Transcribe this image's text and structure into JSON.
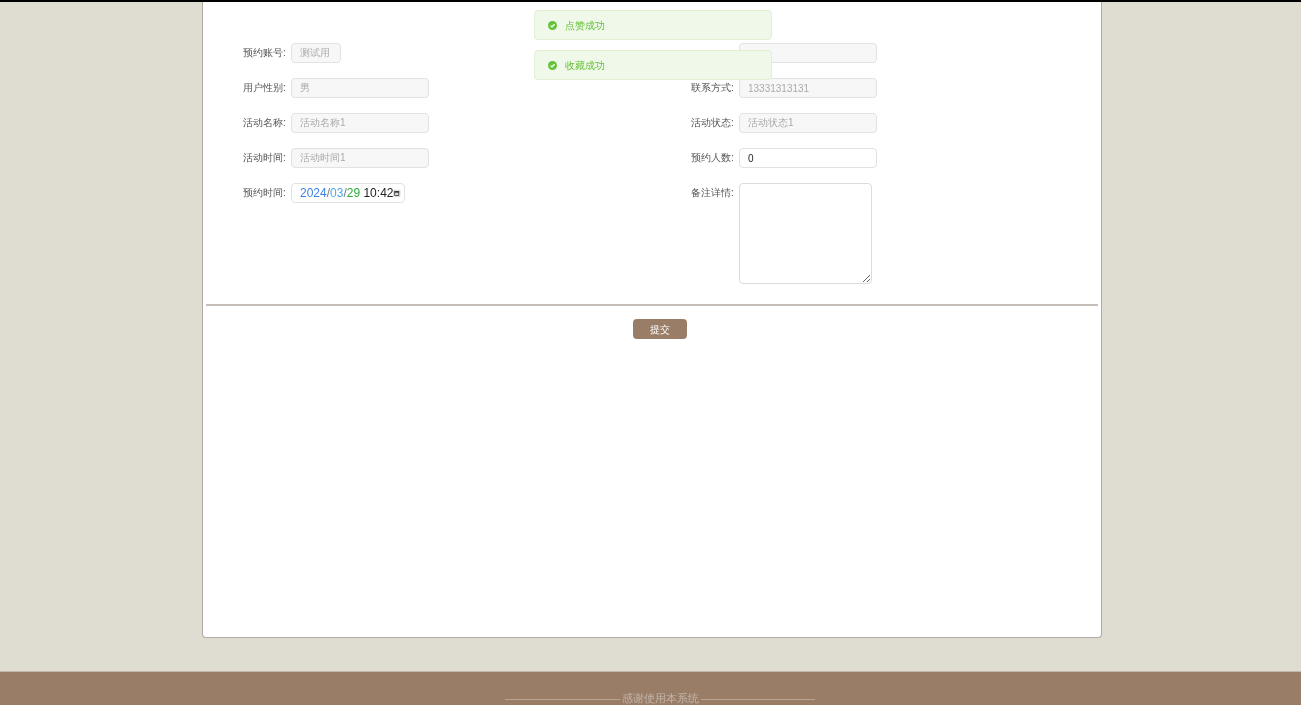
{
  "toasts": [
    {
      "kind": "success",
      "text": "点赞成功"
    },
    {
      "kind": "success",
      "text": "收藏成功"
    }
  ],
  "form": {
    "left": [
      {
        "kind": "short",
        "label": "预约账号:",
        "value": "测试用",
        "disabled": true
      },
      {
        "kind": "input",
        "label": "用户性别:",
        "value": "男",
        "disabled": true
      },
      {
        "kind": "input",
        "label": "活动名称:",
        "value": "活动名称1",
        "disabled": true
      },
      {
        "kind": "input",
        "label": "活动时间:",
        "value": "活动时间1",
        "disabled": true
      },
      {
        "kind": "datetime",
        "label": "预约时间:",
        "parts": [
          {
            "text": "2024",
            "color": "#3a80e0"
          },
          {
            "text": "/"
          },
          {
            "text": "03",
            "color": "#4aa8ee"
          },
          {
            "text": "/"
          },
          {
            "text": "29",
            "color": "#2eaa3c"
          },
          {
            "text": " 10:42",
            "color": "#222222"
          }
        ]
      }
    ],
    "right": [
      {
        "kind": "covered"
      },
      {
        "kind": "input",
        "label": "联系方式:",
        "value": "13331313131",
        "disabled": true
      },
      {
        "kind": "input",
        "label": "活动状态:",
        "value": "活动状态1",
        "disabled": true
      },
      {
        "kind": "input",
        "label": "预约人数:",
        "value": "0",
        "disabled": false
      },
      {
        "kind": "textarea",
        "label": "备注详情:"
      }
    ]
  },
  "submit": "提交",
  "footer": {
    "text": "感谢使用本系统"
  }
}
